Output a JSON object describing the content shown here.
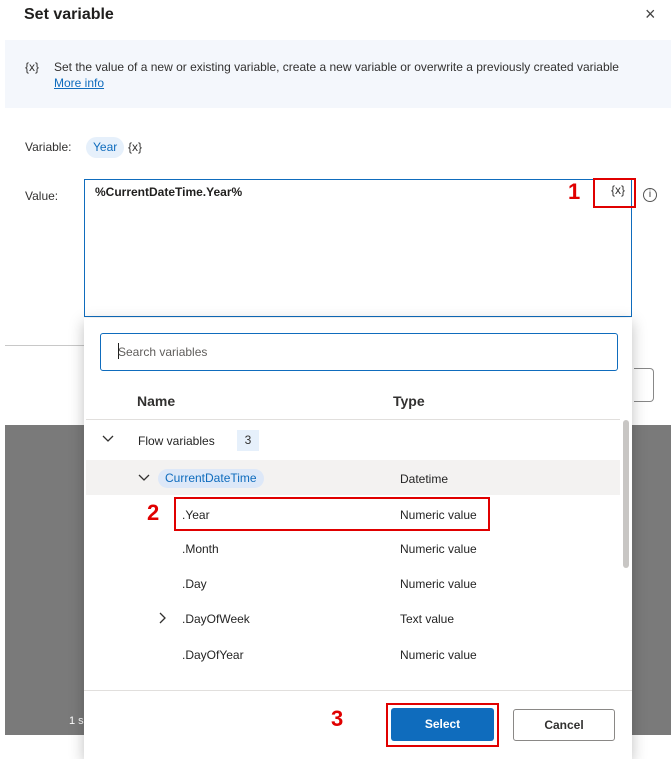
{
  "dialog": {
    "title": "Set variable",
    "close_icon": "×",
    "info": {
      "icon": "{x}",
      "text": "Set the value of a new or existing variable, create a new variable or overwrite a previously created variable",
      "link": "More info"
    },
    "variable_label": "Variable:",
    "variable_name": "Year",
    "variable_icon": "{x}",
    "value_label": "Value:",
    "value_text": "%CurrentDateTime.Year%",
    "value_var_button": "{x}",
    "info_icon": "i",
    "background_fragment": "1 s"
  },
  "annotations": {
    "one": "1",
    "two": "2",
    "three": "3"
  },
  "picker": {
    "search_placeholder": "Search variables",
    "columns": {
      "name": "Name",
      "type": "Type"
    },
    "group": {
      "label": "Flow variables",
      "count": "3",
      "chevron": "chevron-down-icon"
    },
    "parent": {
      "name": "CurrentDateTime",
      "type": "Datetime"
    },
    "rows": [
      {
        "name": ".Year",
        "type": "Numeric value"
      },
      {
        "name": ".Month",
        "type": "Numeric value"
      },
      {
        "name": ".Day",
        "type": "Numeric value"
      },
      {
        "name": ".DayOfWeek",
        "type": "Text value"
      },
      {
        "name": ".DayOfYear",
        "type": "Numeric value"
      }
    ],
    "select_label": "Select",
    "cancel_label": "Cancel"
  },
  "colors": {
    "accent": "#0f6cbd",
    "annotation": "#e00000",
    "chip_bg": "#e6f0fb"
  }
}
